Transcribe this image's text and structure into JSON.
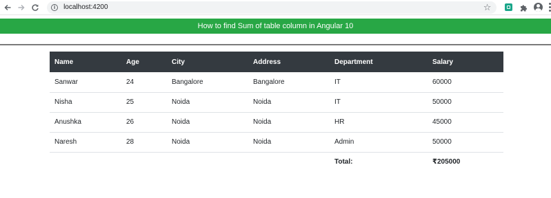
{
  "browser": {
    "url": "localhost:4200",
    "icons": [
      "back-arrow-icon",
      "forward-arrow-icon",
      "reload-icon",
      "info-icon",
      "star-icon",
      "extension-icon",
      "puzzle-icon",
      "profile-icon",
      "menu-dots-icon"
    ]
  },
  "banner": {
    "title": "How to find Sum of table column in Angular 10",
    "color": "#28a745"
  },
  "table": {
    "header_color": "#343a40",
    "headers": [
      "Name",
      "Age",
      "City",
      "Address",
      "Department",
      "Salary"
    ],
    "rows": [
      [
        "Sanwar",
        "24",
        "Bangalore",
        "Bangalore",
        "IT",
        "60000"
      ],
      [
        "Nisha",
        "25",
        "Noida",
        "Noida",
        "IT",
        "50000"
      ],
      [
        "Anushka",
        "26",
        "Noida",
        "Noida",
        "HR",
        "45000"
      ],
      [
        "Naresh",
        "28",
        "Noida",
        "Noida",
        "Admin",
        "50000"
      ]
    ],
    "total_label": "Total:",
    "total_value": "₹205000"
  }
}
